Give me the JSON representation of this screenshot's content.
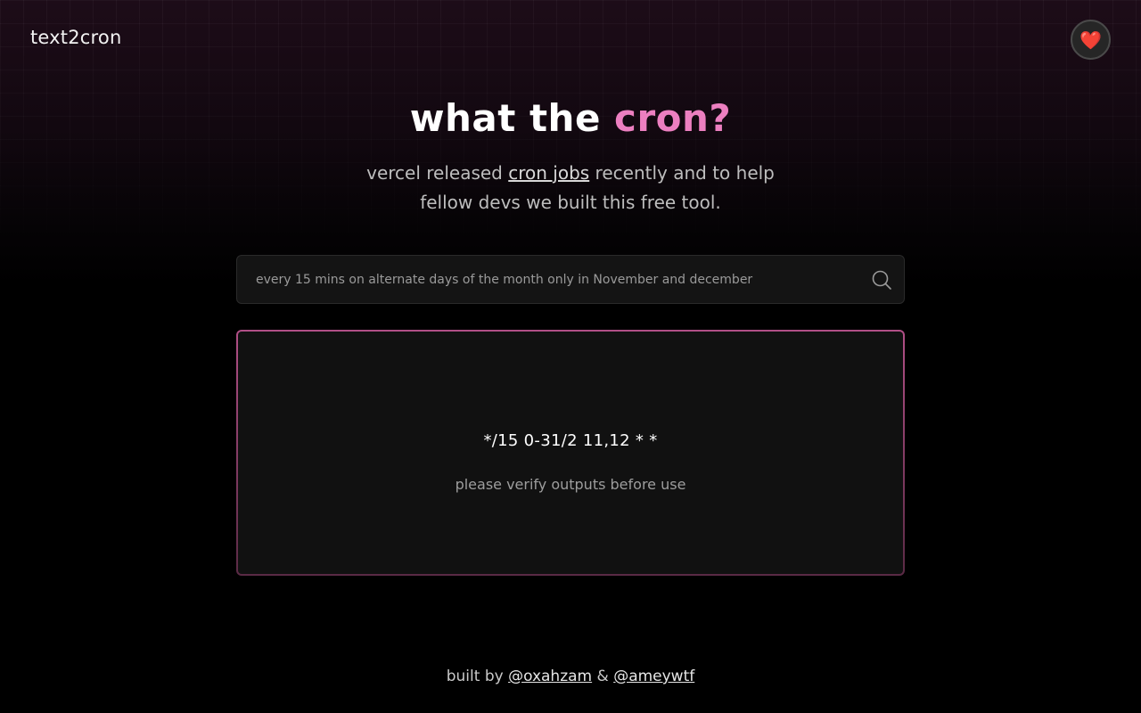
{
  "header": {
    "logo": "text2cron",
    "heart_glyph": "❤️"
  },
  "hero": {
    "title_main": "what the ",
    "title_accent": "cron?",
    "subtitle_before": "vercel released ",
    "subtitle_link": "cron jobs",
    "subtitle_after": " recently and to help fellow devs we built this free tool."
  },
  "search": {
    "value": "every 15 mins on alternate days of the month only in November and december",
    "icon": "search-icon"
  },
  "result": {
    "cron_expression": "*/15 0-31/2 11,12 * *",
    "note": "please verify outputs before use"
  },
  "footer": {
    "prefix": "built by ",
    "author1": "@oxahzam",
    "separator": " & ",
    "author2": "@ameywtf"
  },
  "colors": {
    "accent": "#ec7fc0",
    "background": "#000000",
    "card": "#111111",
    "card_border": "#b04f86"
  }
}
